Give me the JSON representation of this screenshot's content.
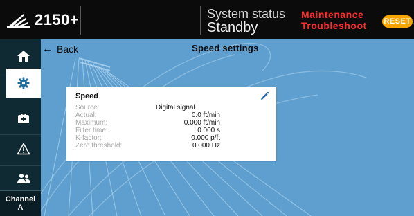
{
  "header": {
    "product": "2150+",
    "status_label": "System status",
    "status_value": "Standby",
    "alerts": [
      "Maintenance",
      "Troubleshoot"
    ],
    "reset_label": "RESET",
    "colors": {
      "alert": "#ff2a2a",
      "reset": "#f7a600"
    }
  },
  "sidebar": {
    "items": [
      {
        "name": "home",
        "icon": "home-icon"
      },
      {
        "name": "settings",
        "icon": "gear-icon",
        "active": true
      },
      {
        "name": "maintenance",
        "icon": "toolbox-icon"
      },
      {
        "name": "warnings",
        "icon": "warning-icon"
      },
      {
        "name": "users",
        "icon": "users-icon"
      }
    ],
    "channel_label_line1": "Channel",
    "channel_label_line2": "A"
  },
  "page": {
    "back_label": "Back",
    "title": "Speed settings"
  },
  "card": {
    "title": "Speed",
    "rows": [
      {
        "label": "Source:",
        "value": "Digital signal"
      },
      {
        "label": "Actual:",
        "value": "0.0 ft/min"
      },
      {
        "label": "Maximum:",
        "value": "0.000 ft/min"
      },
      {
        "label": "Filter time:",
        "value": "0.000 s"
      },
      {
        "label": "K-factor:",
        "value": "0.000 p/ft"
      },
      {
        "label": "Zero threshold:",
        "value": "0.000 Hz"
      }
    ]
  }
}
